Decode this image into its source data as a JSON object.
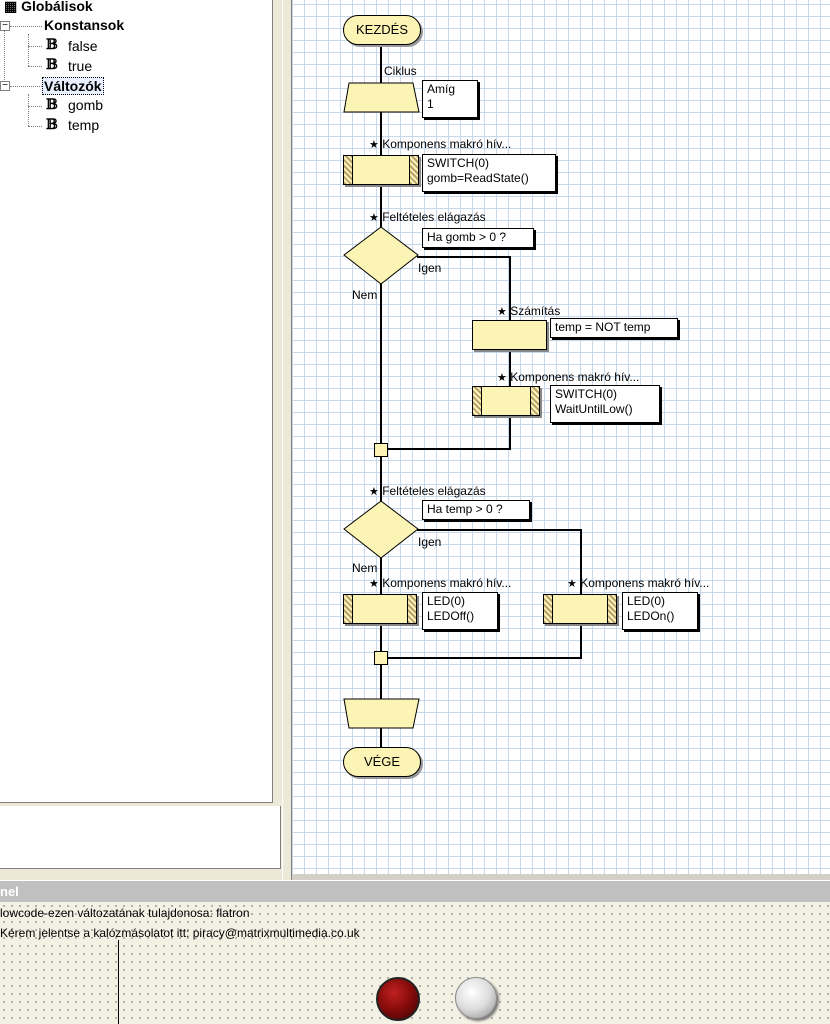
{
  "tree": {
    "globals": "Globálisok",
    "constants": "Konstansok",
    "constants_items": [
      "false",
      "true"
    ],
    "variables": "Változók",
    "variables_items": [
      "gomb",
      "temp"
    ]
  },
  "flowchart": {
    "start": "KEZDÉS",
    "end": "VÉGE",
    "loop_label": "Ciklus",
    "loop_note": [
      "Amíg",
      "1"
    ],
    "macro1_label": "Komponens makró hív...",
    "macro1_note": [
      "SWITCH(0)",
      "gomb=ReadState()"
    ],
    "decision1_label": "Feltételes elágazás",
    "decision1_note": "Ha gomb > 0 ?",
    "yes": "Igen",
    "no": "Nem",
    "calc_label": "Számítás",
    "calc_note": "temp = NOT temp",
    "macro2_label": "Komponens makró hív...",
    "macro2_note": [
      "SWITCH(0)",
      "WaitUntilLow()"
    ],
    "decision2_label": "Feltételes elágazás",
    "decision2_note": "Ha temp > 0 ?",
    "macro3_label": "Komponens makró hív...",
    "macro3_note": [
      "LED(0)",
      "LEDOff()"
    ],
    "macro4_label": "Komponens makró hív...",
    "macro4_note": [
      "LED(0)",
      "LEDOn()"
    ]
  },
  "panel": {
    "title": "nel",
    "message1": "lowcode-ezen változatának tulajdonosa: flatron",
    "message2": "Kérem jelentse a kalózmásolatot itt: piracy@matrixmultimedia.co.uk"
  },
  "colors": {
    "block_fill": "#fcf4b4",
    "grid": "#c7d8ea",
    "led": "#8a0d0d"
  }
}
